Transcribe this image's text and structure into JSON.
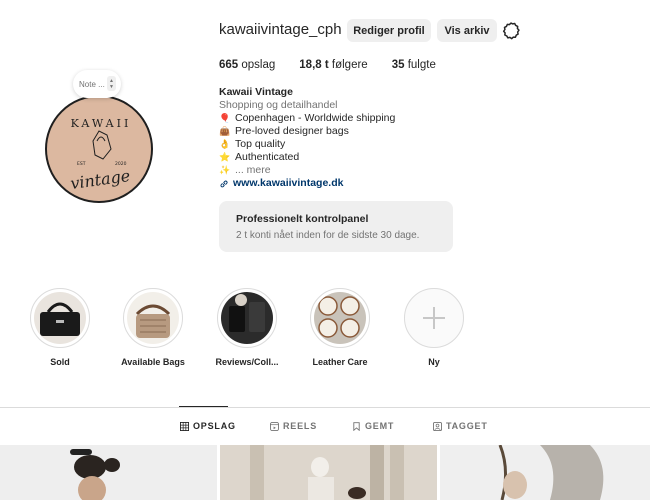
{
  "profile": {
    "username": "kawaiivintage_cph",
    "edit_label": "Rediger profil",
    "archive_label": "Vis arkiv",
    "note_label": "Note ...",
    "avatar_logo_text": "KAWAII",
    "avatar_est_left": "EST",
    "avatar_est_right": "2020",
    "avatar_script": "vintage"
  },
  "stats": [
    {
      "count": "665",
      "label": "opslag"
    },
    {
      "count": "18,8 t",
      "label": "følgere"
    },
    {
      "count": "35",
      "label": "fulgte"
    }
  ],
  "bio": {
    "name": "Kawaii Vintage",
    "category": "Shopping og detailhandel",
    "lines": [
      {
        "icon": "🎈",
        "text": "Copenhagen - Worldwide shipping"
      },
      {
        "icon": "👜",
        "text": "Pre-loved designer bags"
      },
      {
        "icon": "👌",
        "text": "Top quality"
      },
      {
        "icon": "⭐",
        "text": "Authenticated"
      },
      {
        "icon": "✨",
        "text": "... mere"
      }
    ],
    "link": "www.kawaiivintage.dk"
  },
  "dashboard": {
    "title": "Professionelt kontrolpanel",
    "subtitle": "2 t konti nået inden for de sidste 30 dage."
  },
  "highlights": [
    {
      "label": "Sold"
    },
    {
      "label": "Available Bags"
    },
    {
      "label": "Reviews/Coll..."
    },
    {
      "label": "Leather Care"
    },
    {
      "label": "Ny"
    }
  ],
  "tabs": [
    {
      "label": "OPSLAG",
      "icon": "grid-icon",
      "active": true
    },
    {
      "label": "REELS",
      "icon": "reels-icon",
      "active": false
    },
    {
      "label": "GEMT",
      "icon": "bookmark-icon",
      "active": false
    },
    {
      "label": "TAGGET",
      "icon": "tag-icon",
      "active": false
    }
  ],
  "colors": {
    "avatar_bg": "#dcb8a0",
    "link": "#00376b",
    "button_bg": "#efefef",
    "muted": "#737373"
  }
}
